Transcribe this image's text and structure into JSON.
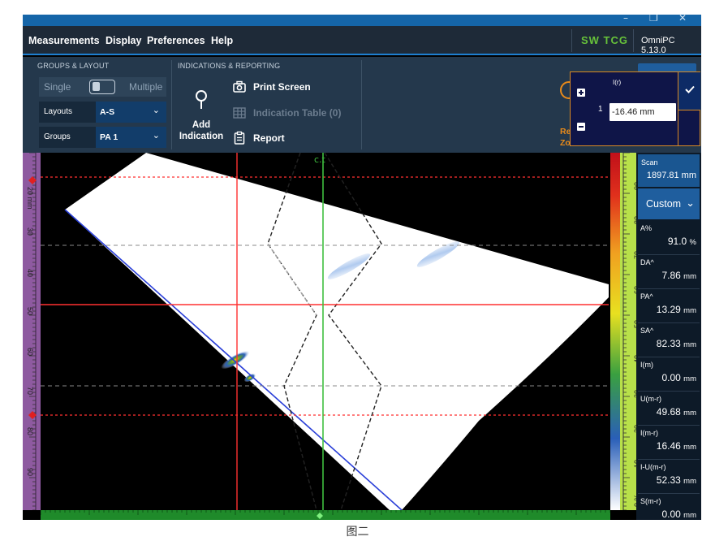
{
  "window": {
    "minimize": "–",
    "restore": "❐",
    "close": "✕"
  },
  "menu": {
    "items": [
      "Measurements",
      "Display",
      "Preferences",
      "Help"
    ],
    "sw_tcg": "SW TCG",
    "version": "OmniPC 5.13.0"
  },
  "ribbon": {
    "groups_title": "GROUPS & LAYOUT",
    "indications_title": "INDICATIONS & REPORTING",
    "toggle_left": "Single",
    "toggle_right": "Multiple",
    "layouts_label": "Layouts",
    "layouts_value": "A-S",
    "groups_label": "Groups",
    "groups_value": "PA 1",
    "add_indication": "Add Indication",
    "print_screen": "Print Screen",
    "indication_table": "Indication Table (0)",
    "report": "Report",
    "re_zo_1": "Re",
    "re_zo_2": "Zo"
  },
  "popup": {
    "header": "I(r)",
    "step": "1",
    "value": "-16.46 mm"
  },
  "scan_view": {
    "top_label": "c.t",
    "left_ruler": [
      "20 mm",
      "30",
      "40",
      "50",
      "60",
      "70",
      "80",
      "90"
    ],
    "right_ruler": [
      "90",
      "80",
      "70",
      "60",
      "50",
      "40",
      "30",
      "20",
      "10",
      "0 %"
    ]
  },
  "readouts": {
    "scan_label": "Scan",
    "scan_value": "1897.81 mm",
    "custom_label": "Custom",
    "items": [
      {
        "label": "A%",
        "value": "91.0",
        "unit": "%"
      },
      {
        "label": "DA^",
        "value": "7.86",
        "unit": "mm"
      },
      {
        "label": "PA^",
        "value": "13.29",
        "unit": "mm"
      },
      {
        "label": "SA^",
        "value": "82.33",
        "unit": "mm"
      },
      {
        "label": "I(m)",
        "value": "0.00",
        "unit": "mm"
      },
      {
        "label": "U(m-r)",
        "value": "49.68",
        "unit": "mm"
      },
      {
        "label": "I(m-r)",
        "value": "16.46",
        "unit": "mm"
      },
      {
        "label": "I-U(m-r)",
        "value": "52.33",
        "unit": "mm"
      },
      {
        "label": "S(m-r)",
        "value": "0.00",
        "unit": "mm"
      }
    ]
  },
  "caption": "图二",
  "colors": {
    "cursor_red": "#ff3030",
    "cursor_green": "#3fbf3f",
    "probe_blue": "#2a3fd8",
    "accent_orange": "#e88a1a"
  }
}
